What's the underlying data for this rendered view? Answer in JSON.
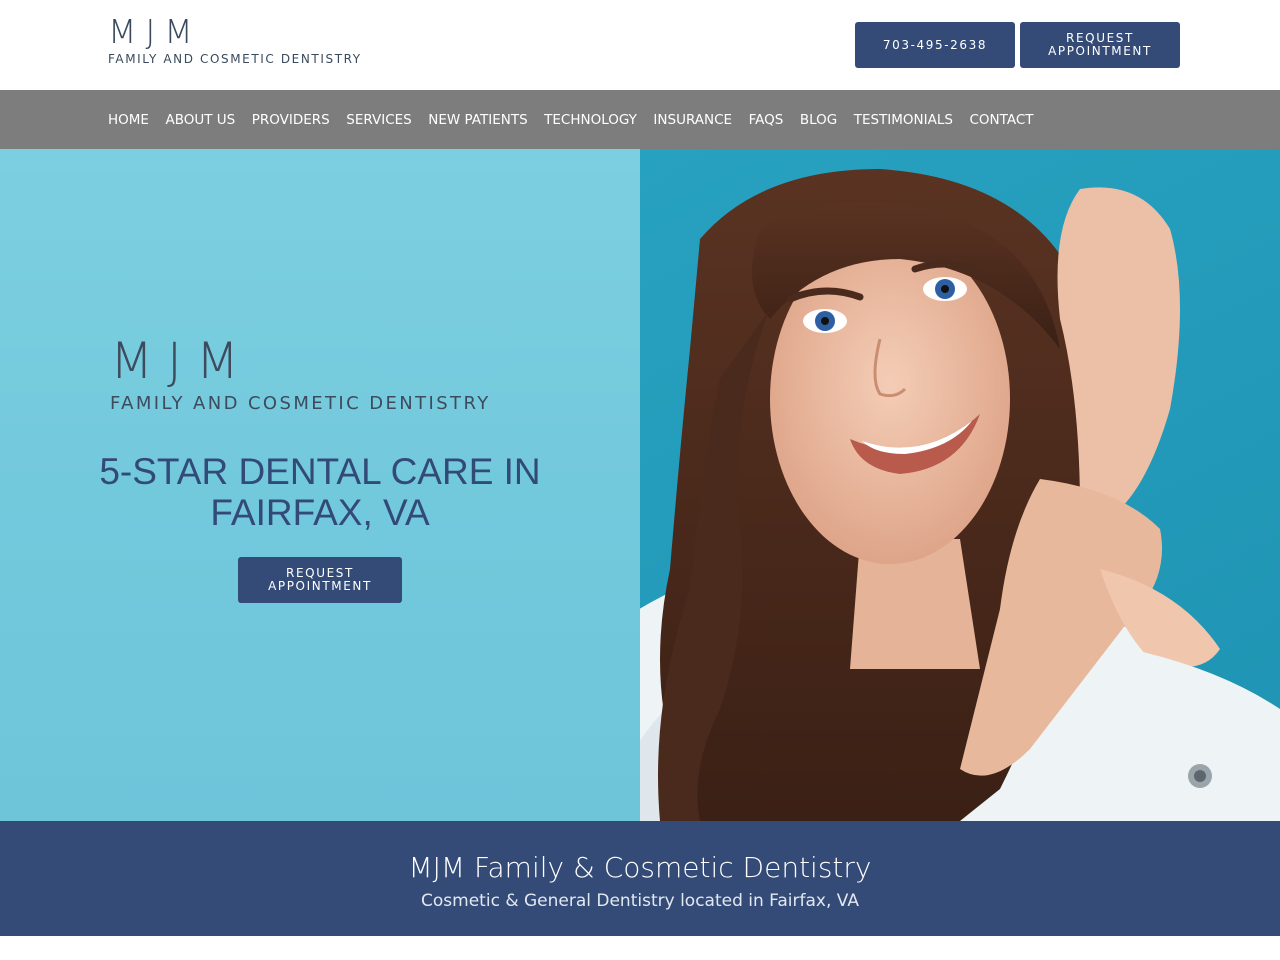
{
  "header": {
    "logo_mark": "MJM",
    "logo_sub": "FAMILY AND COSMETIC DENTISTRY",
    "phone_label": "703-495-2638",
    "request_label": "REQUEST\nAPPOINTMENT"
  },
  "nav": {
    "items": [
      "HOME",
      "ABOUT US",
      "PROVIDERS",
      "SERVICES",
      "NEW PATIENTS",
      "TECHNOLOGY",
      "INSURANCE",
      "FAQS",
      "BLOG",
      "TESTIMONIALS",
      "CONTACT"
    ]
  },
  "hero": {
    "logo_mark": "MJM",
    "logo_sub": "FAMILY AND COSMETIC DENTISTRY",
    "title_line1": "5-STAR DENTAL CARE IN",
    "title_line2": "FAIRFAX, VA",
    "request_label_line1": "REQUEST",
    "request_label_line2": "APPOINTMENT"
  },
  "band": {
    "title": "MJM Family & Cosmetic Dentistry",
    "subtitle": "Cosmetic & General Dentistry located in Fairfax, VA"
  },
  "colors": {
    "brand_navy": "#344b78",
    "nav_gray": "#7d7d7d",
    "hero_teal": "#2ea7c4",
    "hero_light": "#7ccfe0"
  }
}
